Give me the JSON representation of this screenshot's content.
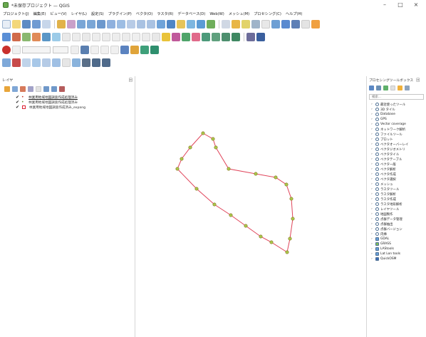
{
  "window": {
    "title": "*未保存プロジェクト — QGIS",
    "minimize": "–",
    "maximize": "□",
    "close": "×"
  },
  "menubar": {
    "items": [
      "プロジェクト(J)",
      "編集(E)",
      "ビュー(V)",
      "レイヤ(L)",
      "設定(S)",
      "プラグイン(P)",
      "ベクタ(O)",
      "ラスタ(R)",
      "データベース(D)",
      "Web(W)",
      "メッシュ(M)",
      "プロセシング(C)",
      "ヘルプ(H)"
    ]
  },
  "layers_panel": {
    "title": "レイヤ",
    "close": "回",
    "layers": [
      {
        "checked": "✔",
        "symbol": "point",
        "name": "林業用地域地図調査作成処理済み",
        "active": true
      },
      {
        "checked": "✔",
        "symbol": "point",
        "name": "林業用地域地図調査作成処理済み",
        "active": false
      },
      {
        "checked": "✔",
        "symbol": "polygon",
        "name": "林業用地域地図調査作成済み_expang",
        "active": false
      }
    ]
  },
  "map": {
    "polygon_color": "#e0445a",
    "vertex_color": "#a8c94c",
    "vertex_stroke": "#8a6f1d"
  },
  "processing_panel": {
    "title": "プロセシングツールボックス",
    "close": "回",
    "search_placeholder": "検索...",
    "tools": [
      {
        "name": "最近使ったツール",
        "icon": "recent-icon"
      },
      {
        "name": "3D タイル",
        "icon": "gear-icon"
      },
      {
        "name": "Database",
        "icon": "gear-icon"
      },
      {
        "name": "GPS",
        "icon": "gear-icon"
      },
      {
        "name": "Vector coverage",
        "icon": "gear-icon"
      },
      {
        "name": "ネットワーク解析",
        "icon": "gear-icon"
      },
      {
        "name": "ファイルツール",
        "icon": "gear-icon"
      },
      {
        "name": "プロット",
        "icon": "gear-icon"
      },
      {
        "name": "ベクタオーバーレイ",
        "icon": "gear-icon"
      },
      {
        "name": "ベクタジオメトリ",
        "icon": "gear-icon"
      },
      {
        "name": "ベクタタイル",
        "icon": "gear-icon"
      },
      {
        "name": "ベクタテーブル",
        "icon": "gear-icon"
      },
      {
        "name": "ベクタ一般",
        "icon": "gear-icon"
      },
      {
        "name": "ベクタ解析",
        "icon": "gear-icon"
      },
      {
        "name": "ベクタ作成",
        "icon": "gear-icon"
      },
      {
        "name": "ベクタ選択",
        "icon": "gear-icon"
      },
      {
        "name": "メッシュ",
        "icon": "gear-icon"
      },
      {
        "name": "ラスタツール",
        "icon": "gear-icon"
      },
      {
        "name": "ラスタ解析",
        "icon": "gear-icon"
      },
      {
        "name": "ラスタ作成",
        "icon": "gear-icon"
      },
      {
        "name": "ラスタ地形解析",
        "icon": "gear-icon"
      },
      {
        "name": "レイヤツール",
        "icon": "gear-icon"
      },
      {
        "name": "地図製作",
        "icon": "gear-icon"
      },
      {
        "name": "点群データ管理",
        "icon": "gear-icon"
      },
      {
        "name": "点群抽出",
        "icon": "gear-icon"
      },
      {
        "name": "点群バージョン",
        "icon": "gear-icon"
      },
      {
        "name": "内挿",
        "icon": "gear-icon"
      },
      {
        "name": "GDAL",
        "icon": "gdal-icon"
      },
      {
        "name": "GRASS",
        "icon": "grass-icon"
      },
      {
        "name": "LAStools",
        "icon": "lastools-icon"
      },
      {
        "name": "Lat Lon tools",
        "icon": "latlon-icon"
      },
      {
        "name": "QuickOSM",
        "icon": "quickosm-icon"
      }
    ]
  }
}
